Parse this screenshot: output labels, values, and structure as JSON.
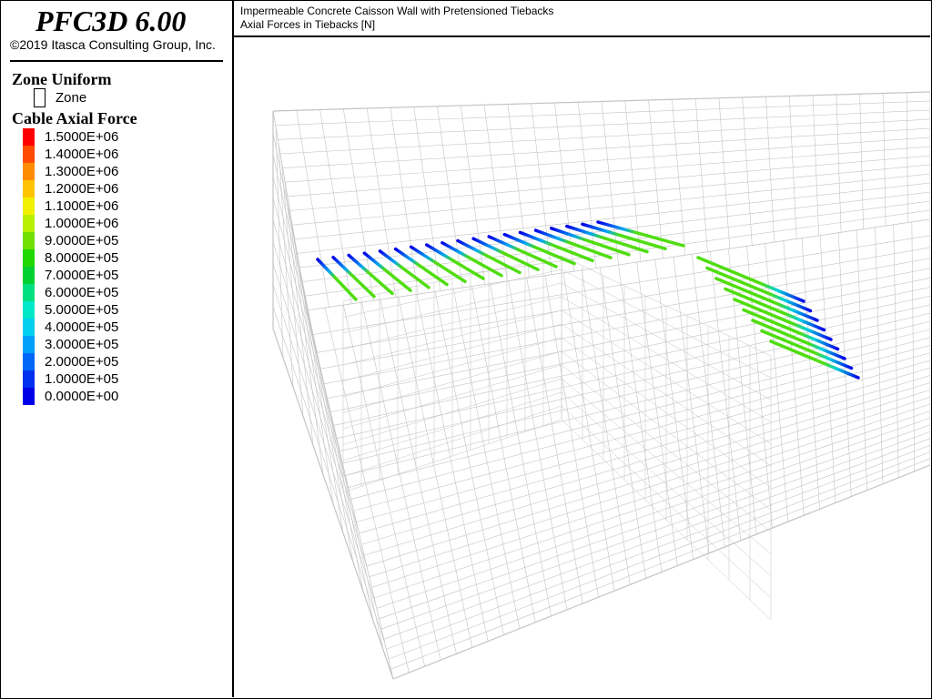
{
  "header": {
    "app_title": "PFC3D 6.00",
    "copyright": "©2019 Itasca Consulting Group, Inc."
  },
  "plot_title": {
    "line1": "Impermeable Concrete Caisson Wall with Pretensioned Tiebacks",
    "line2": "Axial Forces in Tiebacks [N]"
  },
  "legend": {
    "zone_heading": "Zone Uniform",
    "zone_item": "Zone",
    "cable_heading": "Cable Axial Force",
    "entries": [
      {
        "label": "1.5000E+06",
        "color": "#ff0000"
      },
      {
        "label": "1.4000E+06",
        "color": "#ff4a00"
      },
      {
        "label": "1.3000E+06",
        "color": "#ff8c00"
      },
      {
        "label": "1.2000E+06",
        "color": "#ffc400"
      },
      {
        "label": "1.1000E+06",
        "color": "#f0f000"
      },
      {
        "label": "1.0000E+06",
        "color": "#b8f000"
      },
      {
        "label": "9.0000E+05",
        "color": "#70e000"
      },
      {
        "label": "8.0000E+05",
        "color": "#20d800"
      },
      {
        "label": "7.0000E+05",
        "color": "#00d030"
      },
      {
        "label": "6.0000E+05",
        "color": "#00e080"
      },
      {
        "label": "5.0000E+05",
        "color": "#00e8c8"
      },
      {
        "label": "4.0000E+05",
        "color": "#00d0f0"
      },
      {
        "label": "3.0000E+05",
        "color": "#00a0f8"
      },
      {
        "label": "2.0000E+05",
        "color": "#0068f8"
      },
      {
        "label": "1.0000E+05",
        "color": "#0030f0"
      },
      {
        "label": "0.0000E+00",
        "color": "#0000e8"
      }
    ]
  },
  "colors": {
    "mesh": "#c4c4c4",
    "cable_low": "#0000e8",
    "cable_high": "#50dd10"
  }
}
